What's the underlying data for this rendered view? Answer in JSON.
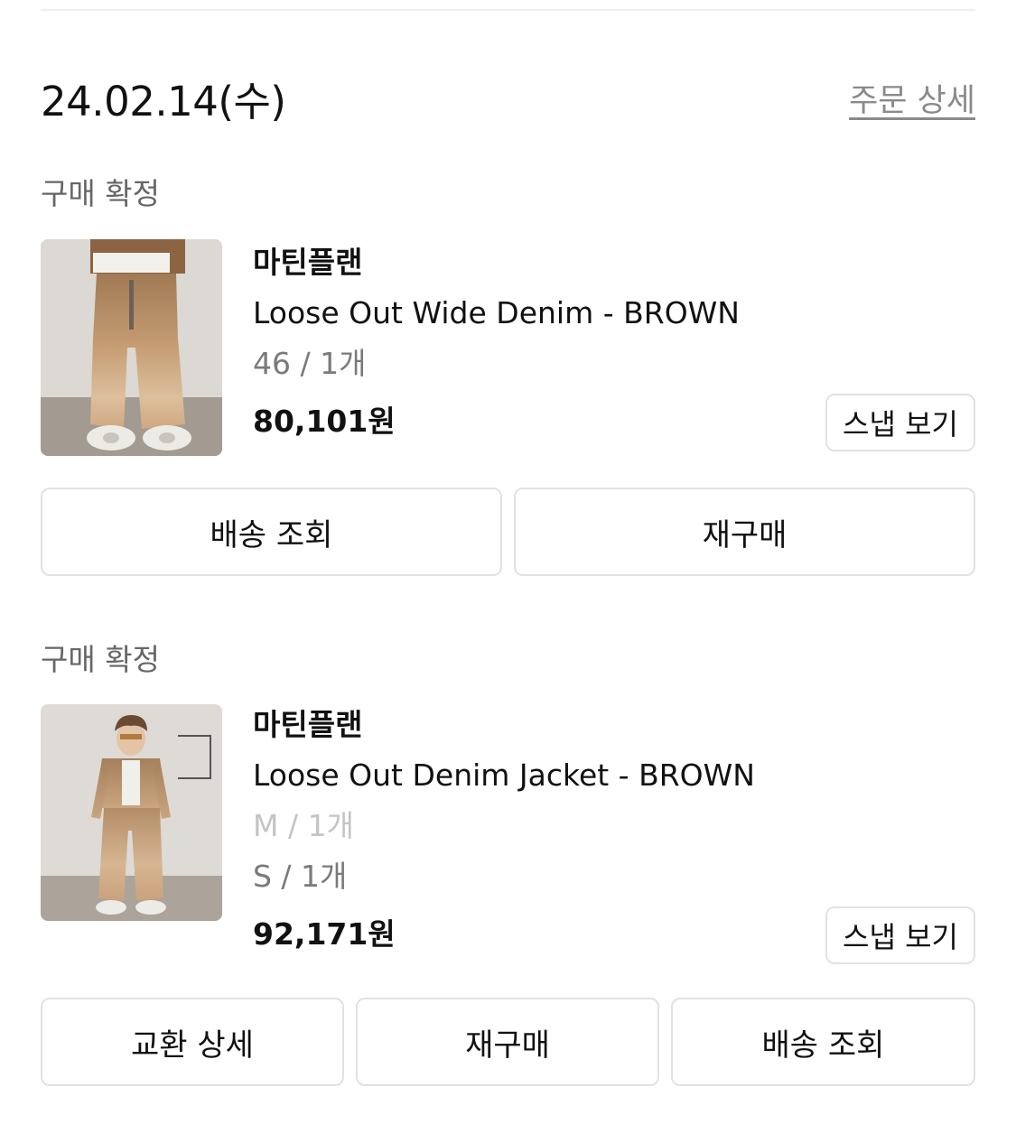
{
  "order": {
    "date": "24.02.14(수)",
    "detail_link": "주문 상세"
  },
  "items": [
    {
      "status": "구매 확정",
      "brand": "마틴플랜",
      "name": "Loose Out Wide Denim - BROWN",
      "options": [
        "46 / 1개"
      ],
      "price": "80,101원",
      "snap_button": "스냅 보기",
      "actions": [
        "배송 조회",
        "재구매"
      ]
    },
    {
      "status": "구매 확정",
      "brand": "마틴플랜",
      "name": "Loose Out Denim Jacket - BROWN",
      "options": [
        "M / 1개",
        "S / 1개"
      ],
      "price": "92,171원",
      "snap_button": "스냅 보기",
      "actions": [
        "교환 상세",
        "재구매",
        "배송 조회"
      ]
    }
  ]
}
